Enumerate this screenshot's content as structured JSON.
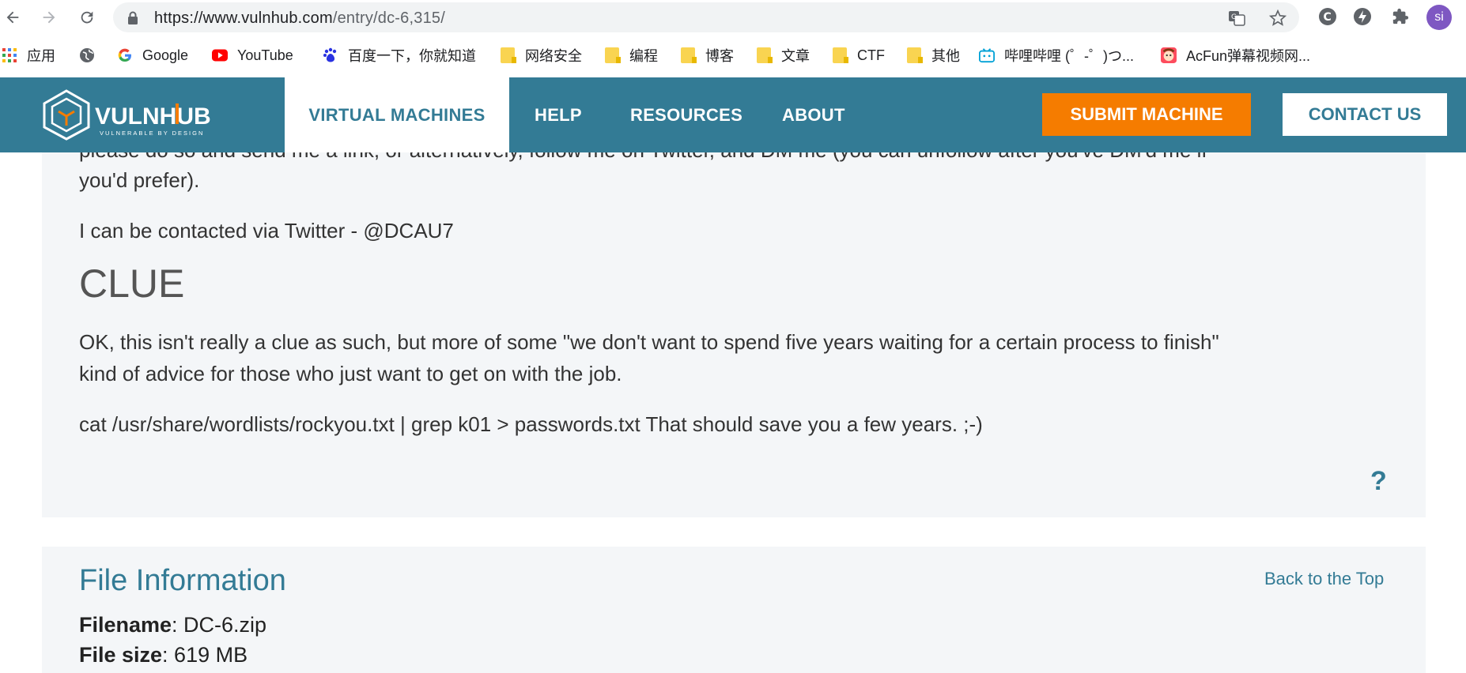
{
  "browser": {
    "url_main": "https://www.vulnhub.com",
    "url_path": "/entry/dc-6,315/",
    "avatar": "si",
    "bookmarks": [
      {
        "label": "应用",
        "icon": "apps-grid-icon"
      },
      {
        "label": "",
        "icon": "globe-icon"
      },
      {
        "label": "Google",
        "icon": "google-icon"
      },
      {
        "label": "YouTube",
        "icon": "youtube-icon"
      },
      {
        "label": "百度一下，你就知道",
        "icon": "baidu-icon"
      },
      {
        "label": "网络安全",
        "icon": "folder-icon"
      },
      {
        "label": "编程",
        "icon": "folder-icon"
      },
      {
        "label": "博客",
        "icon": "folder-icon"
      },
      {
        "label": "文章",
        "icon": "folder-icon"
      },
      {
        "label": "CTF",
        "icon": "folder-icon"
      },
      {
        "label": "其他",
        "icon": "folder-icon"
      },
      {
        "label": "哔哩哔哩 (゜-゜)つ...",
        "icon": "bilibili-icon"
      },
      {
        "label": "AcFun弹幕视频网...",
        "icon": "acfun-icon"
      }
    ]
  },
  "site": {
    "logo_text": "VULNHUB",
    "logo_tagline": "VULNERABLE BY DESIGN",
    "nav": [
      "VIRTUAL MACHINES",
      "HELP",
      "RESOURCES",
      "ABOUT"
    ],
    "submit_label": "SUBMIT MACHINE",
    "contact_label": "CONTACT US"
  },
  "content": {
    "cut_line": "please do so and send me a link, or alternatively, follow me on Twitter, and DM me (you can unfollow after you've DM'd me if",
    "cut_line_2": "you'd prefer).",
    "contact_line": "I can be contacted via Twitter - @DCAU7",
    "clue_heading": "CLUE",
    "clue_line_1": "OK, this isn't really a clue as such, but more of some \"we don't want to spend five years waiting for a certain process to finish\"",
    "clue_line_2": "kind of advice for those who just want to get on with the job.",
    "clue_cmd": "cat /usr/share/wordlists/rockyou.txt | grep k01 > passwords.txt That should save you a few years. ;-)",
    "question_mark": "?"
  },
  "file_info": {
    "heading": "File Information",
    "back_to_top": "Back to the Top",
    "filename_label": "Filename",
    "filename_value": ": DC-6.zip",
    "filesize_label": "File size",
    "filesize_value": ": 619 MB"
  },
  "colors": {
    "header": "#337b95",
    "accent_orange": "#f57c00",
    "panel_bg": "#f4f6f8"
  }
}
